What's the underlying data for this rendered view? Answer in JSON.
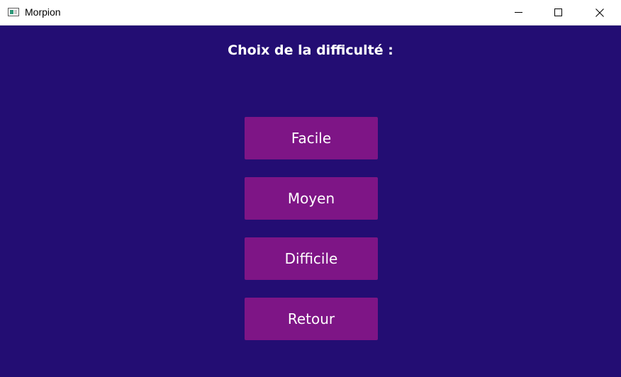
{
  "window": {
    "title": "Morpion"
  },
  "screen": {
    "heading": "Choix de la difficulté :",
    "buttons": {
      "easy": "Facile",
      "medium": "Moyen",
      "hard": "Difficile",
      "back": "Retour"
    }
  },
  "colors": {
    "background": "#230d73",
    "button": "#7e1586",
    "text": "#ffffff"
  }
}
